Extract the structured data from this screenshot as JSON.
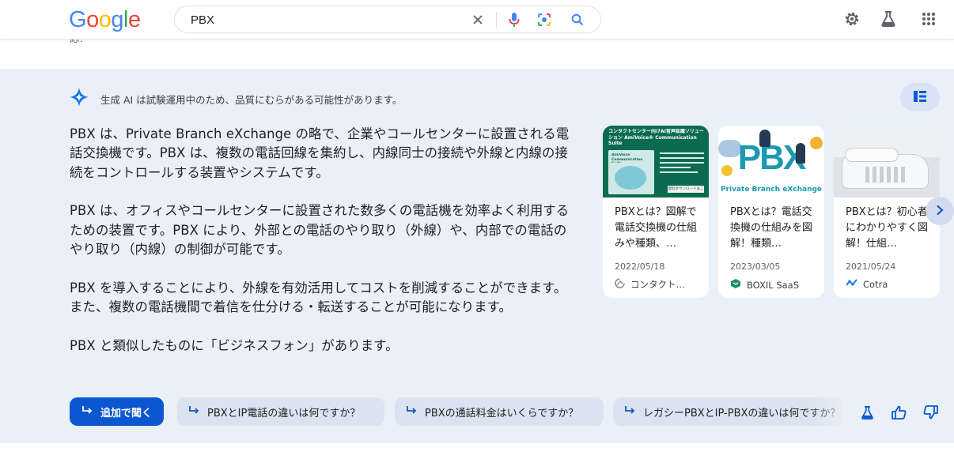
{
  "header": {
    "logo": [
      "G",
      "o",
      "o",
      "g",
      "l",
      "e"
    ],
    "search_value": "PBX",
    "icons": {
      "clear": "close-icon",
      "voice": "microphone-icon",
      "lens": "lens-icon",
      "search": "search-icon",
      "settings": "gear-icon",
      "labs": "flask-icon",
      "apps": "apps-grid-icon"
    }
  },
  "remnant_text": "応！",
  "ai_overview": {
    "disclaimer": "生成 AI は試験運用中のため、品質にむらがある可能性があります。",
    "paragraphs": [
      "PBX は、Private Branch eXchange の略で、企業やコールセンターに設置される電話交換機です。PBX は、複数の電話回線を集約し、内線同士の接続や外線と内線の接続をコントロールする装置やシステムです。",
      "PBX は、オフィスやコールセンターに設置された数多くの電話機を効率よく利用するための装置です。PBX により、外部との電話のやり取り（外線）や、内部での電話のやり取り（内線）の制御が可能です。",
      "PBX を導入することにより、外線を有効活用してコストを削減することができます。また、複数の電話機間で着信を仕分ける・転送することが可能になります。",
      "PBX と類似したものに「ビジネスフォン」があります。"
    ],
    "cards": [
      {
        "title": "PBXとは？図解で電話交換機の仕組みや種類、…",
        "date": "2022/05/18",
        "source": "コンタクト…",
        "thumb_heading": "コンタクトセンター向けAI音声認識ソリューション AmiVoice® Communication Suite",
        "thumb_badge": "AmiVoice Communication Suite",
        "thumb_button": "資料ダウンロードはこちら"
      },
      {
        "title": "PBXとは？電話交換機の仕組みを図解！種類…",
        "date": "2023/03/05",
        "source": "BOXIL SaaS",
        "thumb_big": "PBX",
        "thumb_caption": "Private Branch eXchange"
      },
      {
        "title": "PBXとは？初心者にわかりやすく図解！仕組…",
        "date": "2021/05/24",
        "source": "Cotra"
      }
    ],
    "followup_label": "追加で聞く",
    "suggestions": [
      "PBXとIP電話の違いは何ですか？",
      "PBXの通話料金はいくらですか？",
      "レガシーPBXとIP-PBXの違いは何ですか？"
    ]
  },
  "colors": {
    "accent_blue": "#0b57d0",
    "panel_bg": "#eaf0f8",
    "chip_bg": "#dbe3f0",
    "card1_green": "#0b6b50",
    "card2_teal": "#1a9ab0"
  }
}
